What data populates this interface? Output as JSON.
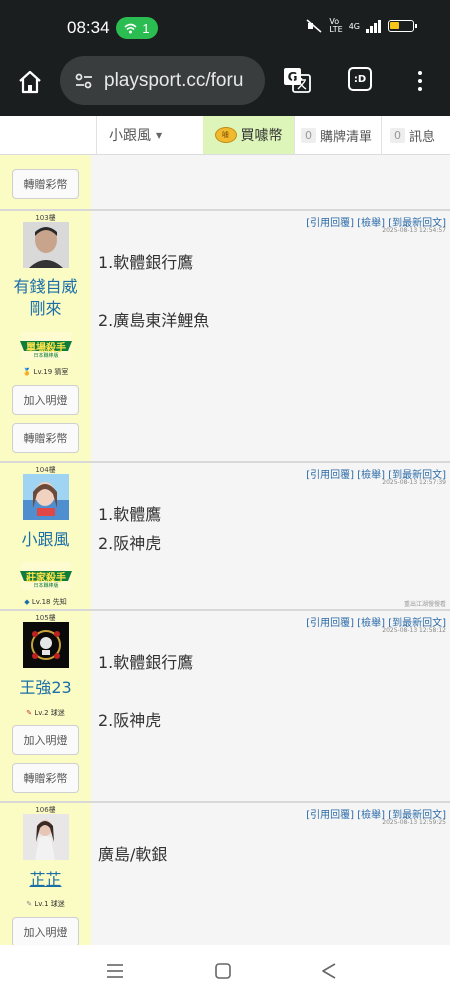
{
  "status_bar": {
    "time": "08:34",
    "hotspot_count": "1",
    "network_label": "4G"
  },
  "browser": {
    "url": "playsport.cc/foru",
    "dex_label": ":D"
  },
  "site_nav": {
    "user": "小跟風",
    "buy_label": "買噱幣",
    "coin_label": "噱",
    "cart_count": "0",
    "cart_label": "購牌清單",
    "msg_count": "0",
    "msg_label": "訊息"
  },
  "partial_post": {
    "gift_button": "轉贈彩幣"
  },
  "post_actions": {
    "reply_quote": "[引用回覆]",
    "report": "[檢舉]",
    "latest": "[到最新回文]"
  },
  "posts": [
    {
      "floor": "103樓",
      "username_line1": "有錢自威",
      "username_line2": "剛來",
      "badge_title": "單場殺手",
      "badge_sub": "日本職棒版",
      "level": "Lv.19 猜室",
      "light_button": "加入明燈",
      "gift_button": "轉贈彩幣",
      "time": "2025-08-13 12:54:57",
      "lines": [
        "1.軟體銀行鷹",
        "2.廣島東洋鯉魚"
      ]
    },
    {
      "floor": "104樓",
      "username_line1": "小跟風",
      "badge_title": "莊家殺手",
      "badge_sub": "日本職棒版",
      "level": "Lv.18 先知",
      "time": "2025-08-13 12:57:39",
      "lines": [
        "1.軟體鷹",
        "2.阪神虎"
      ],
      "signature": "重出江湖慢慢看"
    },
    {
      "floor": "105樓",
      "username_line1": "王強23",
      "level": "Lv.2 球迷",
      "light_button": "加入明燈",
      "gift_button": "轉贈彩幣",
      "time": "2025-08-13 12:58:12",
      "lines": [
        "1.軟體銀行鷹",
        "2.阪神虎"
      ]
    },
    {
      "floor": "106樓",
      "username_line1": "芷芷",
      "level": "Lv.1 球迷",
      "light_button": "加入明燈",
      "time": "2025-08-13 12:59:25",
      "lines": [
        "廣島/軟銀"
      ]
    }
  ],
  "colors": {
    "sidebar_bg": "#fbfbc4",
    "link_blue": "#1a6fa8",
    "buy_bg": "#ddf5b9",
    "hotspot_green": "#2bbd52"
  },
  "icons": [
    "home-icon",
    "tune-icon",
    "translate-icon",
    "menu-icon",
    "recents-icon",
    "home-square-icon",
    "back-icon"
  ]
}
